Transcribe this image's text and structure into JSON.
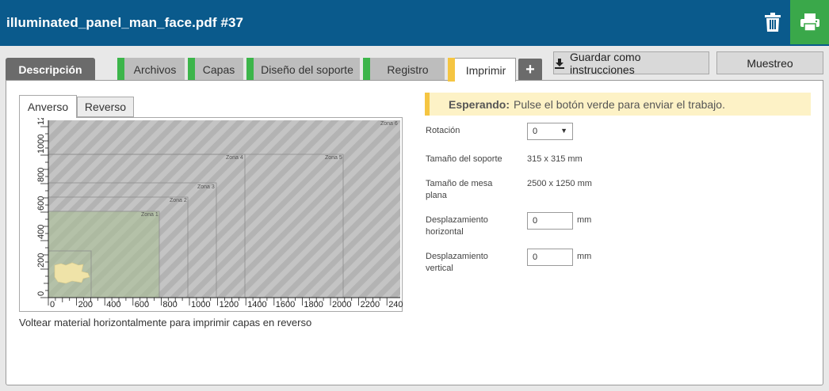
{
  "header": {
    "title": "illuminated_panel_man_face.pdf #37",
    "trash_icon": "trash-icon",
    "print_icon": "printer-icon",
    "print_color": "#3aa84a",
    "bar_color": "#0a5a8c"
  },
  "tabs": [
    {
      "label": "Descripción"
    },
    {
      "label": "Archivos"
    },
    {
      "label": "Capas"
    },
    {
      "label": "Diseño del soporte"
    },
    {
      "label": "Registro"
    },
    {
      "label": "Imprimir"
    },
    {
      "label": "+"
    }
  ],
  "toolbar": {
    "save_label": "Guardar como instrucciones",
    "sample_label": "Muestreo"
  },
  "preview_tabs": {
    "front": "Anverso",
    "back": "Reverso"
  },
  "preview": {
    "x_ticks": [
      "0",
      "200",
      "400",
      "600",
      "800",
      "1000",
      "1200",
      "1400",
      "1600",
      "1800",
      "2000",
      "2200",
      "240"
    ],
    "y_ticks": [
      "0",
      "200",
      "400",
      "600",
      "800",
      "1000",
      "1200"
    ],
    "zones": [
      "Zona 1",
      "Zona 2",
      "Zona 3",
      "Zona 4",
      "Zona 5",
      "Zona 6"
    ]
  },
  "caption": "Voltear material horizontalmente para imprimir capas en reverso",
  "notice": {
    "bold": "Esperando:",
    "text": "Pulse el botón verde para enviar el trabajo."
  },
  "settings": {
    "rotation_label": "Rotación",
    "rotation_value": "0",
    "media_size_label": "Tamaño del soporte",
    "media_size_value": "315 x 315 mm",
    "table_size_label": "Tamaño de mesa plana",
    "table_size_value": "2500 x 1250 mm",
    "h_offset_label": "Desplazamiento horizontal",
    "h_offset_value": "0",
    "v_offset_label": "Desplazamiento vertical",
    "v_offset_value": "0",
    "unit": "mm"
  }
}
